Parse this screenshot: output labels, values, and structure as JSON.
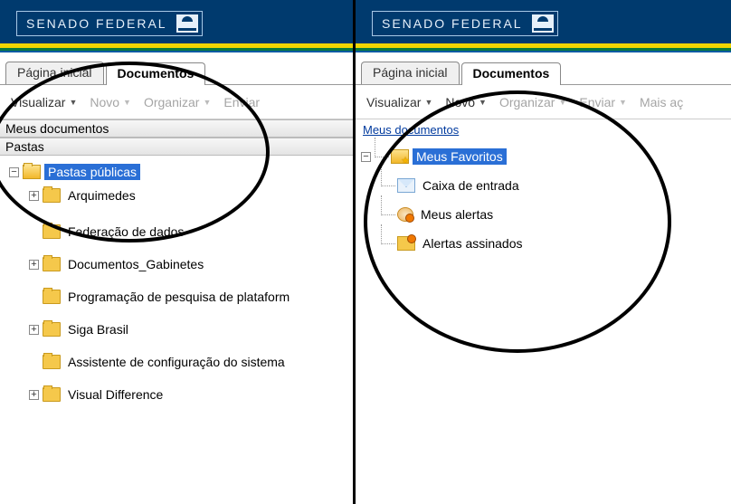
{
  "brand": "SENADO FEDERAL",
  "tabs": {
    "home": "Página inicial",
    "docs": "Documentos"
  },
  "toolbar": {
    "visualizar": "Visualizar",
    "novo": "Novo",
    "organizar": "Organizar",
    "enviar": "Enviar",
    "mais": "Mais aç"
  },
  "left": {
    "myDocs": "Meus documentos",
    "folders": "Pastas",
    "publicFolders": "Pastas públicas",
    "items": {
      "arquimedes": "Arquimedes",
      "federacao": "Federação de dados",
      "docGabinetes": "Documentos_Gabinetes",
      "programacao": "Programação de pesquisa de plataform",
      "siga": "Siga Brasil",
      "assistente": "Assistente de configuração do sistema",
      "visual": "Visual Difference"
    }
  },
  "right": {
    "myDocs": "Meus documentos",
    "items": {
      "favoritos": "Meus Favoritos",
      "inbox": "Caixa de entrada",
      "alertas": "Meus alertas",
      "assinados": "Alertas assinados"
    }
  }
}
